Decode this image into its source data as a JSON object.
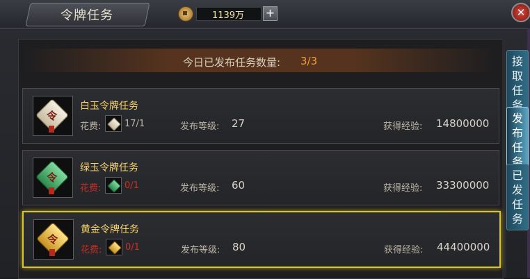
{
  "header": {
    "title": "令牌任务",
    "currency_amount": "1139万",
    "add_label": "+",
    "close_label": "✕"
  },
  "summary": {
    "label": "今日已发布任务数量:",
    "count": "3/3"
  },
  "tasks": [
    {
      "name": "白玉令牌任务",
      "cost_label": "花费:",
      "cost_value": "17/1",
      "level_label": "发布等级:",
      "level": "27",
      "exp_label": "获得经验:",
      "exp": "14800000",
      "token_glyph": "令",
      "token_color": "#f4efe2",
      "affordable": true
    },
    {
      "name": "绿玉令牌任务",
      "cost_label": "花费:",
      "cost_value": "0/1",
      "level_label": "发布等级:",
      "level": "60",
      "exp_label": "获得经验:",
      "exp": "33300000",
      "token_glyph": "令",
      "token_color": "#5cc47f",
      "affordable": false
    },
    {
      "name": "黄金令牌任务",
      "cost_label": "花费:",
      "cost_value": "0/1",
      "level_label": "发布等级:",
      "level": "80",
      "exp_label": "获得经验:",
      "exp": "44400000",
      "token_glyph": "令",
      "token_color": "#f0c24a",
      "affordable": false,
      "selected": true
    }
  ],
  "tabs": [
    {
      "label": "接取任务",
      "active": false
    },
    {
      "label": "发布任务",
      "active": true
    },
    {
      "label": "已发任务",
      "active": false
    }
  ],
  "colors": {
    "highlight_border": "#d9c42f",
    "count_orange": "#f0a030",
    "insufficient_red": "#c92f25",
    "task_name_gold": "#f5d36a"
  }
}
